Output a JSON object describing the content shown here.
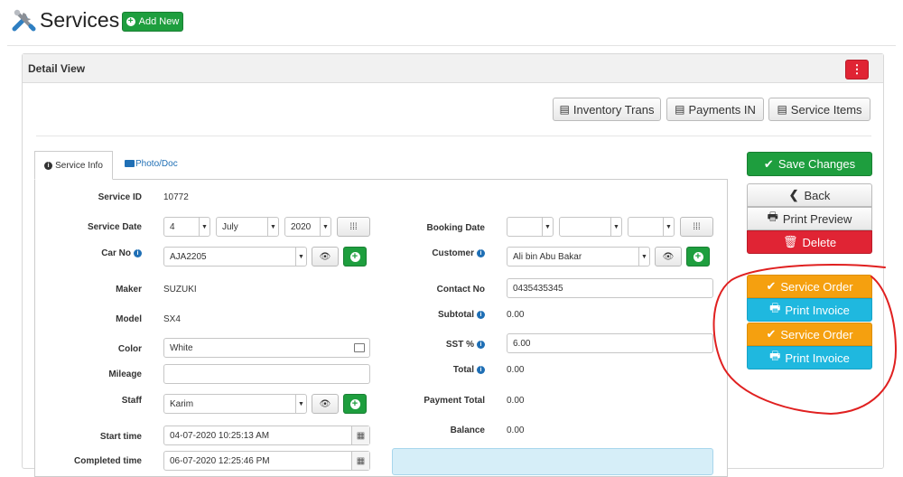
{
  "header": {
    "title": "Services",
    "add_new_label": "Add New"
  },
  "panel": {
    "title": "Detail View",
    "kebab": "⋮",
    "toolbar": {
      "inventory_trans": "Inventory Trans",
      "payments_in": "Payments IN",
      "service_items": "Service Items"
    }
  },
  "tabs": {
    "service_info": "Service Info",
    "photo_doc": "Photo/Doc"
  },
  "form": {
    "service_id": {
      "label": "Service ID",
      "value": "10772"
    },
    "service_date": {
      "label": "Service Date",
      "day": "4",
      "month": "July",
      "year": "2020"
    },
    "car_no": {
      "label": "Car No",
      "value": "AJA2205"
    },
    "maker": {
      "label": "Maker",
      "value": "SUZUKI"
    },
    "model": {
      "label": "Model",
      "value": "SX4"
    },
    "color": {
      "label": "Color",
      "value": "White"
    },
    "mileage": {
      "label": "Mileage",
      "value": ""
    },
    "staff": {
      "label": "Staff",
      "value": "Karim"
    },
    "start_time": {
      "label": "Start time",
      "value": "04-07-2020 10:25:13 AM"
    },
    "completed_time": {
      "label": "Completed time",
      "value": "06-07-2020 12:25:46 PM"
    },
    "booking_date": {
      "label": "Booking Date",
      "day": "",
      "month": "",
      "year": ""
    },
    "customer": {
      "label": "Customer",
      "value": "Ali bin Abu Bakar"
    },
    "contact_no": {
      "label": "Contact No",
      "value": "0435435345"
    },
    "subtotal": {
      "label": "Subtotal",
      "value": "0.00"
    },
    "sst": {
      "label": "SST %",
      "value": "6.00"
    },
    "total": {
      "label": "Total",
      "value": "0.00"
    },
    "payment_total": {
      "label": "Payment Total",
      "value": "0.00"
    },
    "balance": {
      "label": "Balance",
      "value": "0.00"
    }
  },
  "actions": {
    "save_changes": "Save Changes",
    "back": "Back",
    "print_preview": "Print Preview",
    "delete": "Delete",
    "service_order_1": "Service Order",
    "print_invoice_1": "Print Invoice",
    "service_order_2": "Service Order",
    "print_invoice_2": "Print Invoice"
  },
  "colors": {
    "green": "#1e9e3e",
    "red": "#e02434",
    "orange": "#f5a00f",
    "cyan": "#1fb8df",
    "link_blue": "#1f6fb5",
    "annotation_red": "#e02020"
  },
  "icons": [
    "tools-icon",
    "plus-circle-icon",
    "list-icon",
    "info-icon",
    "folder-icon",
    "calendar-icon",
    "eye-icon",
    "check-icon",
    "chevron-left-icon",
    "print-icon",
    "trash-icon"
  ]
}
